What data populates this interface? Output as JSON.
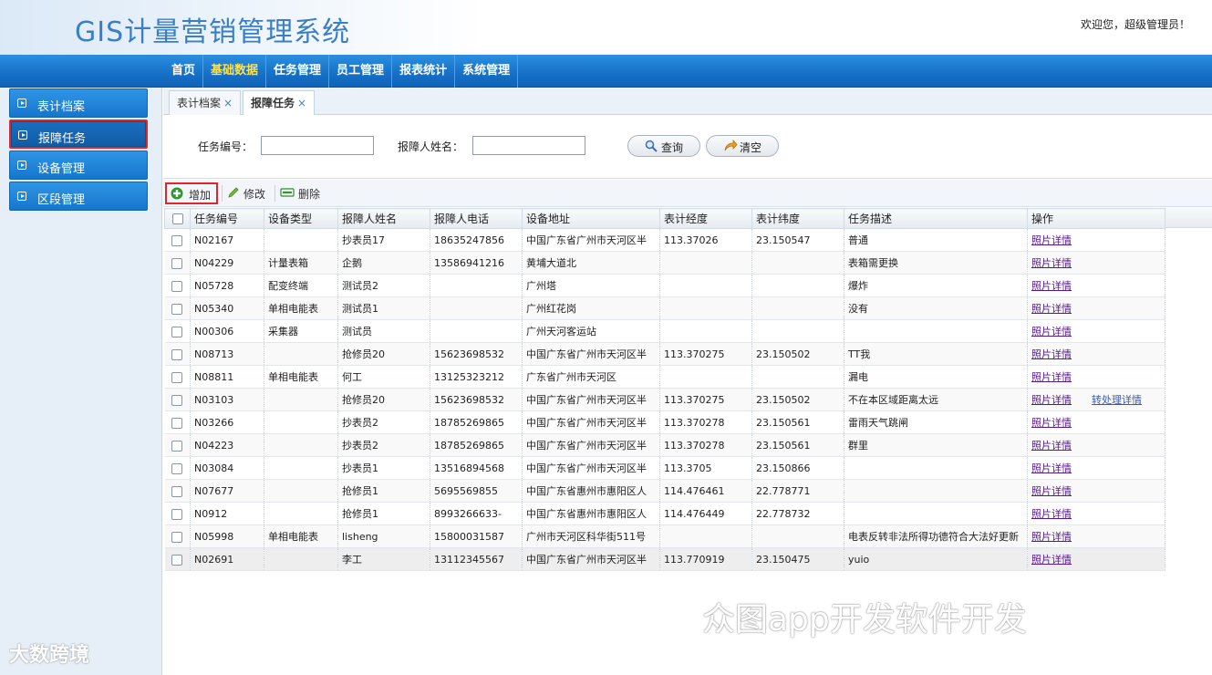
{
  "app": {
    "title": "GIS计量营销管理系统",
    "welcome": "欢迎您，超级管理员！"
  },
  "nav": {
    "items": [
      {
        "label": "首页",
        "active": false
      },
      {
        "label": "基础数据",
        "active": true
      },
      {
        "label": "任务管理",
        "active": false
      },
      {
        "label": "员工管理",
        "active": false
      },
      {
        "label": "报表统计",
        "active": false
      },
      {
        "label": "系统管理",
        "active": false
      }
    ]
  },
  "sidebar": {
    "items": [
      {
        "label": "表计档案",
        "selected": false
      },
      {
        "label": "报障任务",
        "selected": true
      },
      {
        "label": "设备管理",
        "selected": false
      },
      {
        "label": "区段管理",
        "selected": false
      }
    ]
  },
  "tabs": [
    {
      "label": "表计档案",
      "close": "×",
      "active": false
    },
    {
      "label": "报障任务",
      "close": "×",
      "active": true
    }
  ],
  "search": {
    "task_no_label": "任务编号：",
    "task_no_value": "",
    "reporter_label": "报障人姓名：",
    "reporter_value": "",
    "query_button": "查询",
    "clear_button": "清空"
  },
  "toolbar": {
    "add_label": "增加",
    "edit_label": "修改",
    "delete_label": "删除"
  },
  "table": {
    "columns": [
      "任务编号",
      "设备类型",
      "报障人姓名",
      "报障人电话",
      "设备地址",
      "表计经度",
      "表计纬度",
      "任务描述",
      "操作"
    ],
    "rows": [
      {
        "id": "N02167",
        "type": "",
        "name": "抄表员17",
        "phone": "18635247856",
        "addr": "中国广东省广州市天河区半",
        "lng": "113.37026",
        "lat": "23.150547",
        "desc": "普通",
        "op1": "照片详情",
        "op2": ""
      },
      {
        "id": "N04229",
        "type": "计量表箱",
        "name": "企鹅",
        "phone": "13586941216",
        "addr": "黄埔大道北",
        "lng": "",
        "lat": "",
        "desc": "表箱需更换",
        "op1": "照片详情",
        "op2": ""
      },
      {
        "id": "N05728",
        "type": "配变终端",
        "name": "测试员2",
        "phone": "",
        "addr": "广州塔",
        "lng": "",
        "lat": "",
        "desc": "爆炸",
        "op1": "照片详情",
        "op2": ""
      },
      {
        "id": "N05340",
        "type": "单相电能表",
        "name": "测试员1",
        "phone": "",
        "addr": "广州红花岗",
        "lng": "",
        "lat": "",
        "desc": "没有",
        "op1": "照片详情",
        "op2": ""
      },
      {
        "id": "N00306",
        "type": "采集器",
        "name": "测试员",
        "phone": "",
        "addr": "广州天河客运站",
        "lng": "",
        "lat": "",
        "desc": "",
        "op1": "照片详情",
        "op2": ""
      },
      {
        "id": "N08713",
        "type": "",
        "name": "抢修员20",
        "phone": "15623698532",
        "addr": "中国广东省广州市天河区半",
        "lng": "113.370275",
        "lat": "23.150502",
        "desc": "TT我",
        "op1": "照片详情",
        "op2": ""
      },
      {
        "id": "N08811",
        "type": "单相电能表",
        "name": "何工",
        "phone": "13125323212",
        "addr": "广东省广州市天河区",
        "lng": "",
        "lat": "",
        "desc": "漏电",
        "op1": "照片详情",
        "op2": ""
      },
      {
        "id": "N03103",
        "type": "",
        "name": "抢修员20",
        "phone": "15623698532",
        "addr": "中国广东省广州市天河区半",
        "lng": "113.370275",
        "lat": "23.150502",
        "desc": "不在本区域距离太远",
        "op1": "照片详情",
        "op2": "转处理详情"
      },
      {
        "id": "N03266",
        "type": "",
        "name": "抄表员2",
        "phone": "18785269865",
        "addr": "中国广东省广州市天河区半",
        "lng": "113.370278",
        "lat": "23.150561",
        "desc": "雷雨天气跳闸",
        "op1": "照片详情",
        "op2": ""
      },
      {
        "id": "N04223",
        "type": "",
        "name": "抄表员2",
        "phone": "18785269865",
        "addr": "中国广东省广州市天河区半",
        "lng": "113.370278",
        "lat": "23.150561",
        "desc": "群里",
        "op1": "照片详情",
        "op2": ""
      },
      {
        "id": "N03084",
        "type": "",
        "name": "抄表员1",
        "phone": "13516894568",
        "addr": "中国广东省广州市天河区半",
        "lng": "113.3705",
        "lat": "23.150866",
        "desc": "",
        "op1": "照片详情",
        "op2": ""
      },
      {
        "id": "N07677",
        "type": "",
        "name": "抢修员1",
        "phone": "5695569855",
        "addr": "中国广东省惠州市惠阳区人",
        "lng": "114.476461",
        "lat": "22.778771",
        "desc": "",
        "op1": "照片详情",
        "op2": ""
      },
      {
        "id": "N0912",
        "type": "",
        "name": "抢修员1",
        "phone": "8993266633-",
        "addr": "中国广东省惠州市惠阳区人",
        "lng": "114.476449",
        "lat": "22.778732",
        "desc": "",
        "op1": "照片详情",
        "op2": ""
      },
      {
        "id": "N05998",
        "type": "单相电能表",
        "name": "lisheng",
        "phone": "15800031587",
        "addr": "广州市天河区科华街511号",
        "lng": "",
        "lat": "",
        "desc": "电表反转非法所得功德符合大法好更新",
        "op1": "照片详情",
        "op2": ""
      },
      {
        "id": "N02691",
        "type": "",
        "name": "李工",
        "phone": "13112345567",
        "addr": "中国广东省广州市天河区半",
        "lng": "113.770919",
        "lat": "23.150475",
        "desc": "yuio",
        "op1": "照片详情",
        "op2": ""
      }
    ]
  },
  "watermarks": {
    "left": "大数跨境",
    "right": "众图app开发软件开发"
  },
  "colors": {
    "nav_blue": "#1772c8",
    "nav_active_text": "#ffe14a",
    "highlight_red": "#e0262b",
    "link_purple": "#551a8b"
  }
}
